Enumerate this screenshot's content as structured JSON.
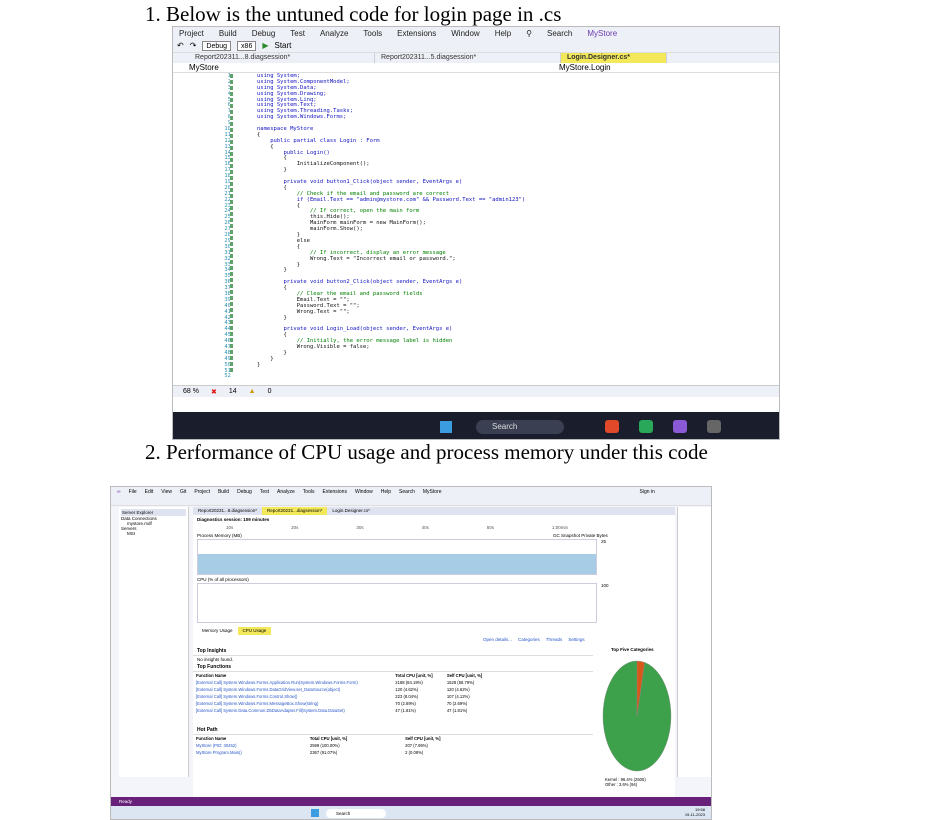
{
  "headings": {
    "h1": "1.  Below is the untuned code for login page in .cs",
    "h2": "2.  Performance of CPU usage and process memory under this code"
  },
  "vs1": {
    "menu": [
      "Project",
      "Build",
      "Debug",
      "Test",
      "Analyze",
      "Tools",
      "Extensions",
      "Window",
      "Help"
    ],
    "search": "Search",
    "solution": "MyStore",
    "config": "Debug",
    "platform": "x86",
    "start": "Start",
    "tabs": [
      "Report202311...8.diagsession*",
      "Report202311...5.diagsession*",
      "Login.Designer.cs*"
    ],
    "nav_left": "MyStore",
    "nav_right": "MyStore.Login",
    "line_numbers": [
      "1",
      "2",
      "3",
      "4",
      "5",
      "6",
      "7",
      "8",
      "9",
      "10",
      "11",
      "12",
      "13",
      "14",
      "15",
      "16",
      "17",
      "18",
      "19",
      "20",
      "21",
      "22",
      "23",
      "24",
      "25",
      "26",
      "27",
      "28",
      "29",
      "30",
      "31",
      "32",
      "33",
      "34",
      "35",
      "36",
      "37",
      "38",
      "39",
      "40",
      "41",
      "42",
      "43",
      "44",
      "45",
      "46",
      "47",
      "48",
      "49",
      "50",
      "51",
      "52"
    ],
    "zoom": "68 %",
    "errors": "14",
    "warnings": "0",
    "taskbar_search": "Search"
  },
  "code": [
    "using System;",
    "using System.ComponentModel;",
    "using System.Data;",
    "using System.Drawing;",
    "using System.Linq;",
    "using System.Text;",
    "using System.Threading.Tasks;",
    "using System.Windows.Forms;",
    "",
    "namespace MyStore",
    "{",
    "    public partial class Login : Form",
    "    {",
    "        public Login()",
    "        {",
    "            InitializeComponent();",
    "        }",
    "",
    "        private void button1_Click(object sender, EventArgs e)",
    "        {",
    "            // Check if the email and password are correct",
    "            if (Email.Text == \"admin@mystore.com\" && Password.Text == \"admin123\")",
    "            {",
    "                // If correct, open the main form",
    "                this.Hide();",
    "                MainForm mainForm = new MainForm();",
    "                mainForm.Show();",
    "            }",
    "            else",
    "            {",
    "                // If incorrect, display an error message",
    "                Wrong.Text = \"Incorrect email or password.\";",
    "            }",
    "        }",
    "",
    "        private void button2_Click(object sender, EventArgs e)",
    "        {",
    "            // Clear the email and password fields",
    "            Email.Text = \"\";",
    "            Password.Text = \"\";",
    "            Wrong.Text = \"\";",
    "        }",
    "",
    "        private void Login_Load(object sender, EventArgs e)",
    "        {",
    "            // Initially, the error message label is hidden",
    "            Wrong.Visible = false;",
    "        }",
    "    }",
    "}"
  ],
  "vs2": {
    "menu": [
      "File",
      "Edit",
      "View",
      "Git",
      "Project",
      "Build",
      "Debug",
      "Test",
      "Analyze",
      "Tools",
      "Extensions",
      "Window",
      "Help"
    ],
    "search": "Search",
    "solution": "MyStore",
    "sign_in": "Sign in",
    "tabs": [
      "Report20231...8.diagsession*",
      "Report20231...diagsession*",
      "Login.Designer.cs*"
    ],
    "server_explorer": "Server Explorer",
    "tree": [
      "Data Connections",
      "mystore.mdf",
      "Servers",
      "MSI"
    ],
    "session": "Diagnostics session: 109 minutes",
    "memory_label": "Process Memory (MB)",
    "memory_legend": [
      "GC",
      "Snapshot",
      "Private Bytes"
    ],
    "cpu_label": "CPU (% of all processors)",
    "ticks": [
      "10s",
      "20s",
      "30s",
      "40s",
      "50s",
      "1:00min"
    ],
    "mem_y": [
      "25",
      "0"
    ],
    "cpu_y": [
      "100",
      "0"
    ],
    "subtabs": [
      "Memory Usage",
      "CPU Usage"
    ],
    "top_insights": "Top Insights",
    "no_insights": "No insights found.",
    "top_functions": "Top Functions",
    "hot_path": "Hot Path",
    "col_fn": "Function Name",
    "col_total": "Total CPU [unit, %]",
    "col_self": "Self CPU [unit, %]",
    "functions": [
      {
        "name": "[External Call] System.Windows.Forms.Application.Run(System.Windows.Forms.Form)",
        "total": "2188 (84.19%)",
        "self": "1528 (58.79%)"
      },
      {
        "name": "[External Call] System.Windows.Forms.DataGridView.set_DataSource(object)",
        "total": "120 (4.62%)",
        "self": "120 (4.62%)"
      },
      {
        "name": "[External Call] System.Windows.Forms.Control.Show()",
        "total": "223 (8.04%)",
        "self": "107 (4.12%)"
      },
      {
        "name": "[External Call] System.Windows.Forms.MessageBox.Show(string)",
        "total": "70 (2.69%)",
        "self": "70 (2.69%)"
      },
      {
        "name": "[External Call] System.Data.Common.DbDataAdapter.Fill(System.Data.DataSet)",
        "total": "47 (1.81%)",
        "self": "47 (1.81%)"
      }
    ],
    "hot_path_rows": [
      {
        "name": "MyStore (PID: 30452)",
        "total": "2599 (100.00%)",
        "self": "207 (7.96%)"
      },
      {
        "name": "MyStore.Program.Main()",
        "total": "2367 (91.07%)",
        "self": "2 (0.08%)"
      }
    ],
    "top_categories": "Top Five Categories",
    "filters": [
      "Open details...",
      "Categories",
      "Threads",
      "Settings"
    ],
    "categories_legend": [
      "Kernel : 96.4% (2505)",
      "Other : 3.6% (94)"
    ],
    "status": "Ready",
    "taskbar_search": "Search",
    "clock": "19:58",
    "date": "19-11-2023"
  },
  "chart_data": {
    "type": "pie",
    "title": "Top Five Categories",
    "categories": [
      "Kernel",
      "Other"
    ],
    "values": [
      96.4,
      3.6
    ]
  }
}
